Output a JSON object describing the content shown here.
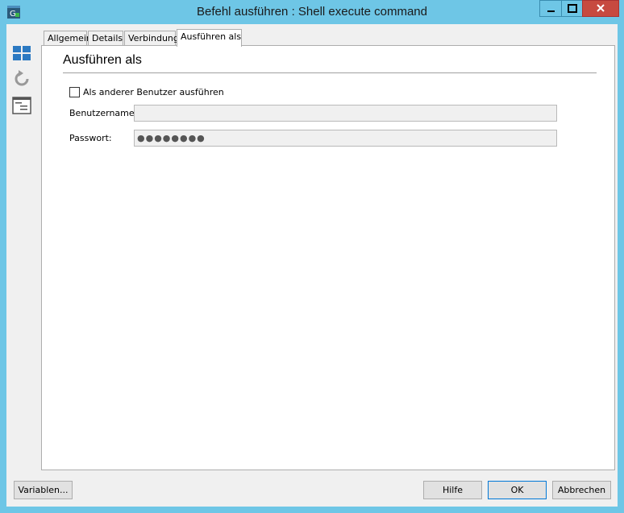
{
  "window": {
    "title": "Befehl ausführen : Shell execute command"
  },
  "sidebar": {
    "icons": [
      "grid-icon",
      "refresh-icon",
      "properties-icon"
    ]
  },
  "tabs": [
    {
      "label": "Allgemein"
    },
    {
      "label": "Details"
    },
    {
      "label": "Verbindung"
    },
    {
      "label": "Ausführen als",
      "active": true
    }
  ],
  "section": {
    "title": "Ausführen als"
  },
  "form": {
    "run_as_other_label": "Als anderer Benutzer ausführen",
    "run_as_other_checked": false,
    "username_label": "Benutzername:",
    "username_value": "",
    "password_label": "Passwort:",
    "password_value": "●●●●●●●●"
  },
  "buttons": {
    "variables": "Variablen...",
    "help": "Hilfe",
    "ok": "OK",
    "cancel": "Abbrechen"
  }
}
